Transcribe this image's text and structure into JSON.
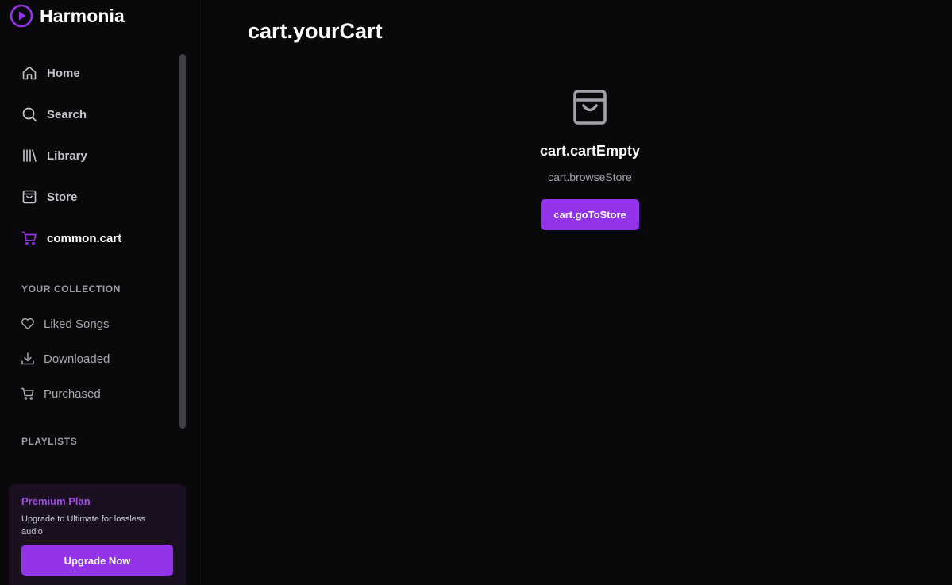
{
  "brand": {
    "name": "Harmonia",
    "logo_icon": "play-circle-icon",
    "accent": "#9333ea"
  },
  "nav": {
    "items": [
      {
        "label": "Home",
        "icon": "home-icon",
        "active": false
      },
      {
        "label": "Search",
        "icon": "search-icon",
        "active": false
      },
      {
        "label": "Library",
        "icon": "library-icon",
        "active": false
      },
      {
        "label": "Store",
        "icon": "shopping-bag-icon",
        "active": false
      },
      {
        "label": "common.cart",
        "icon": "cart-icon",
        "active": true
      }
    ]
  },
  "collection": {
    "title": "YOUR COLLECTION",
    "items": [
      {
        "label": "Liked Songs",
        "icon": "heart-icon"
      },
      {
        "label": "Downloaded",
        "icon": "download-icon"
      },
      {
        "label": "Purchased",
        "icon": "cart-icon"
      }
    ]
  },
  "playlists": {
    "title": "PLAYLISTS"
  },
  "premium": {
    "title": "Premium Plan",
    "description": "Upgrade to Ultimate for lossless audio",
    "button_label": "Upgrade Now"
  },
  "main": {
    "title": "cart.yourCart",
    "empty": {
      "icon": "shopping-bag-icon",
      "title": "cart.cartEmpty",
      "subtitle": "cart.browseStore",
      "button_label": "cart.goToStore"
    }
  }
}
